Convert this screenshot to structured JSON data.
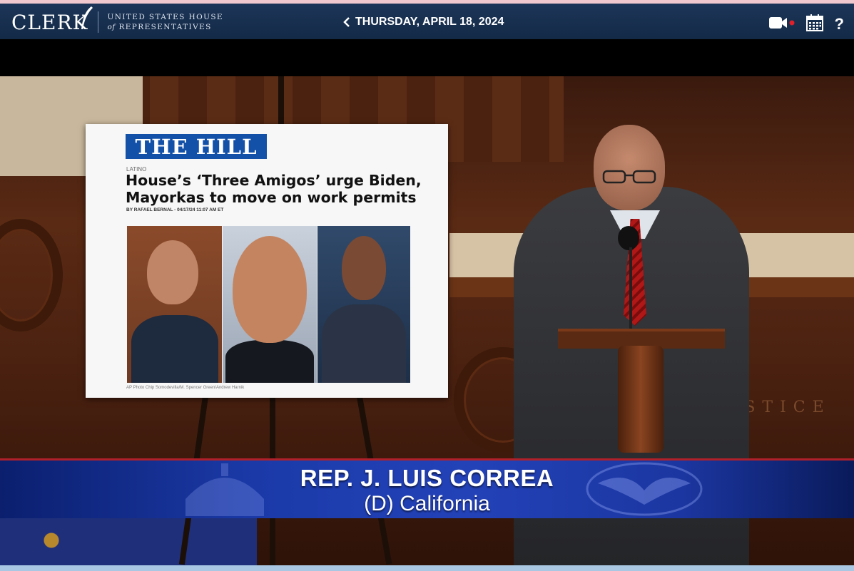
{
  "header": {
    "logo_word": "CLERK",
    "logo_line1": "UNITED STATES HOUSE",
    "logo_line2_italic": "of",
    "logo_line2": "REPRESENTATIVES",
    "date": "THURSDAY, APRIL 18, 2024",
    "icons": [
      "video-live-icon",
      "calendar-icon",
      "help-icon"
    ],
    "help_label": "?",
    "live_color": "#e0202a"
  },
  "video": {
    "poster": {
      "masthead": "THE HILL",
      "section": "LATINO",
      "headline": "House’s ‘Three Amigos’ urge Biden, Mayorkas to move on work permits",
      "byline": "BY RAFAEL BERNAL - 04/17/24 11:07 AM ET",
      "credit": "AP Photo Chip Somodevilla/M. Spencer Green/Andrew Harnik"
    },
    "wall_text": "JUSTICE",
    "lower_third": {
      "name": "REP. J. LUIS CORREA",
      "party_state": "(D) California"
    }
  },
  "colors": {
    "header_bg": "#17304f",
    "lower_third_blue": "#1b3aa8",
    "hill_blue": "#1351a8"
  }
}
